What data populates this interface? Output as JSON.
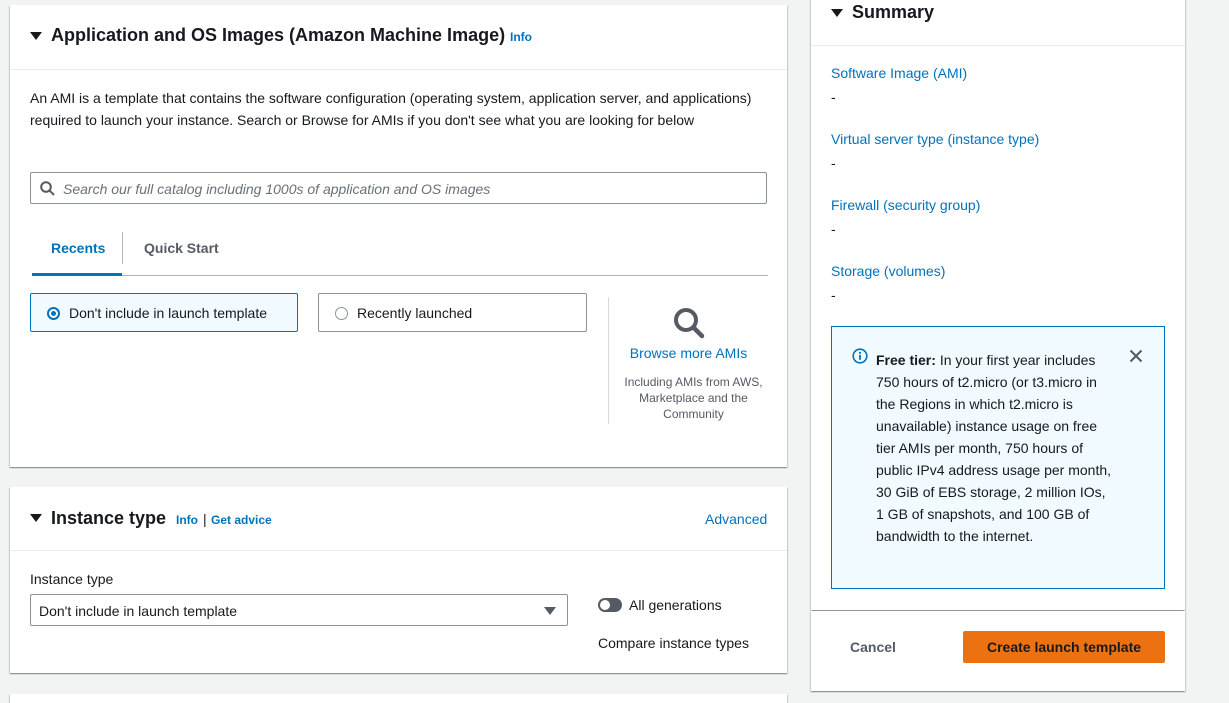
{
  "ami_section": {
    "title": "Application and OS Images (Amazon Machine Image)",
    "info_link": "Info",
    "description": "An AMI is a template that contains the software configuration (operating system, application server, and applications) required to launch your instance. Search or Browse for AMIs if you don't see what you are looking for below",
    "search": {
      "placeholder": "Search our full catalog including 1000s of application and OS images",
      "icon": "search-icon"
    },
    "tabs": [
      {
        "label": "Recents",
        "active": true
      },
      {
        "label": "Quick Start",
        "active": false
      }
    ],
    "options": [
      {
        "label": "Don't include in launch template",
        "selected": true
      },
      {
        "label": "Recently launched",
        "selected": false
      }
    ],
    "browse": {
      "icon": "magnifier-icon",
      "label": "Browse more AMIs",
      "sublabel": "Including AMIs from AWS, Marketplace and the Community"
    }
  },
  "instance_section": {
    "title": "Instance type",
    "info_link": "Info",
    "separator": "|",
    "advice_link": "Get advice",
    "advanced_link": "Advanced",
    "field_label": "Instance type",
    "select_value": "Don't include in launch template",
    "toggle_label": "All generations",
    "toggle_on": false,
    "compare_link": "Compare instance types"
  },
  "summary": {
    "title": "Summary",
    "items": [
      {
        "key": "Software Image (AMI)",
        "value": "-"
      },
      {
        "key": "Virtual server type (instance type)",
        "value": "-"
      },
      {
        "key": "Firewall (security group)",
        "value": "-"
      },
      {
        "key": "Storage (volumes)",
        "value": "-"
      }
    ],
    "free_tier": {
      "title": "Free tier:",
      "text": "In your first year includes 750 hours of t2.micro (or t3.micro in the Regions in which t2.micro is unavailable) instance usage on free tier AMIs per month, 750 hours of public IPv4 address usage per month, 30 GiB of EBS storage, 2 million IOs, 1 GB of snapshots, and 100 GB of bandwidth to the internet."
    },
    "cancel_label": "Cancel",
    "create_label": "Create launch template"
  },
  "colors": {
    "accent": "#0073bb",
    "primary_button": "#ec7211",
    "alert_bg": "#f1faff"
  }
}
